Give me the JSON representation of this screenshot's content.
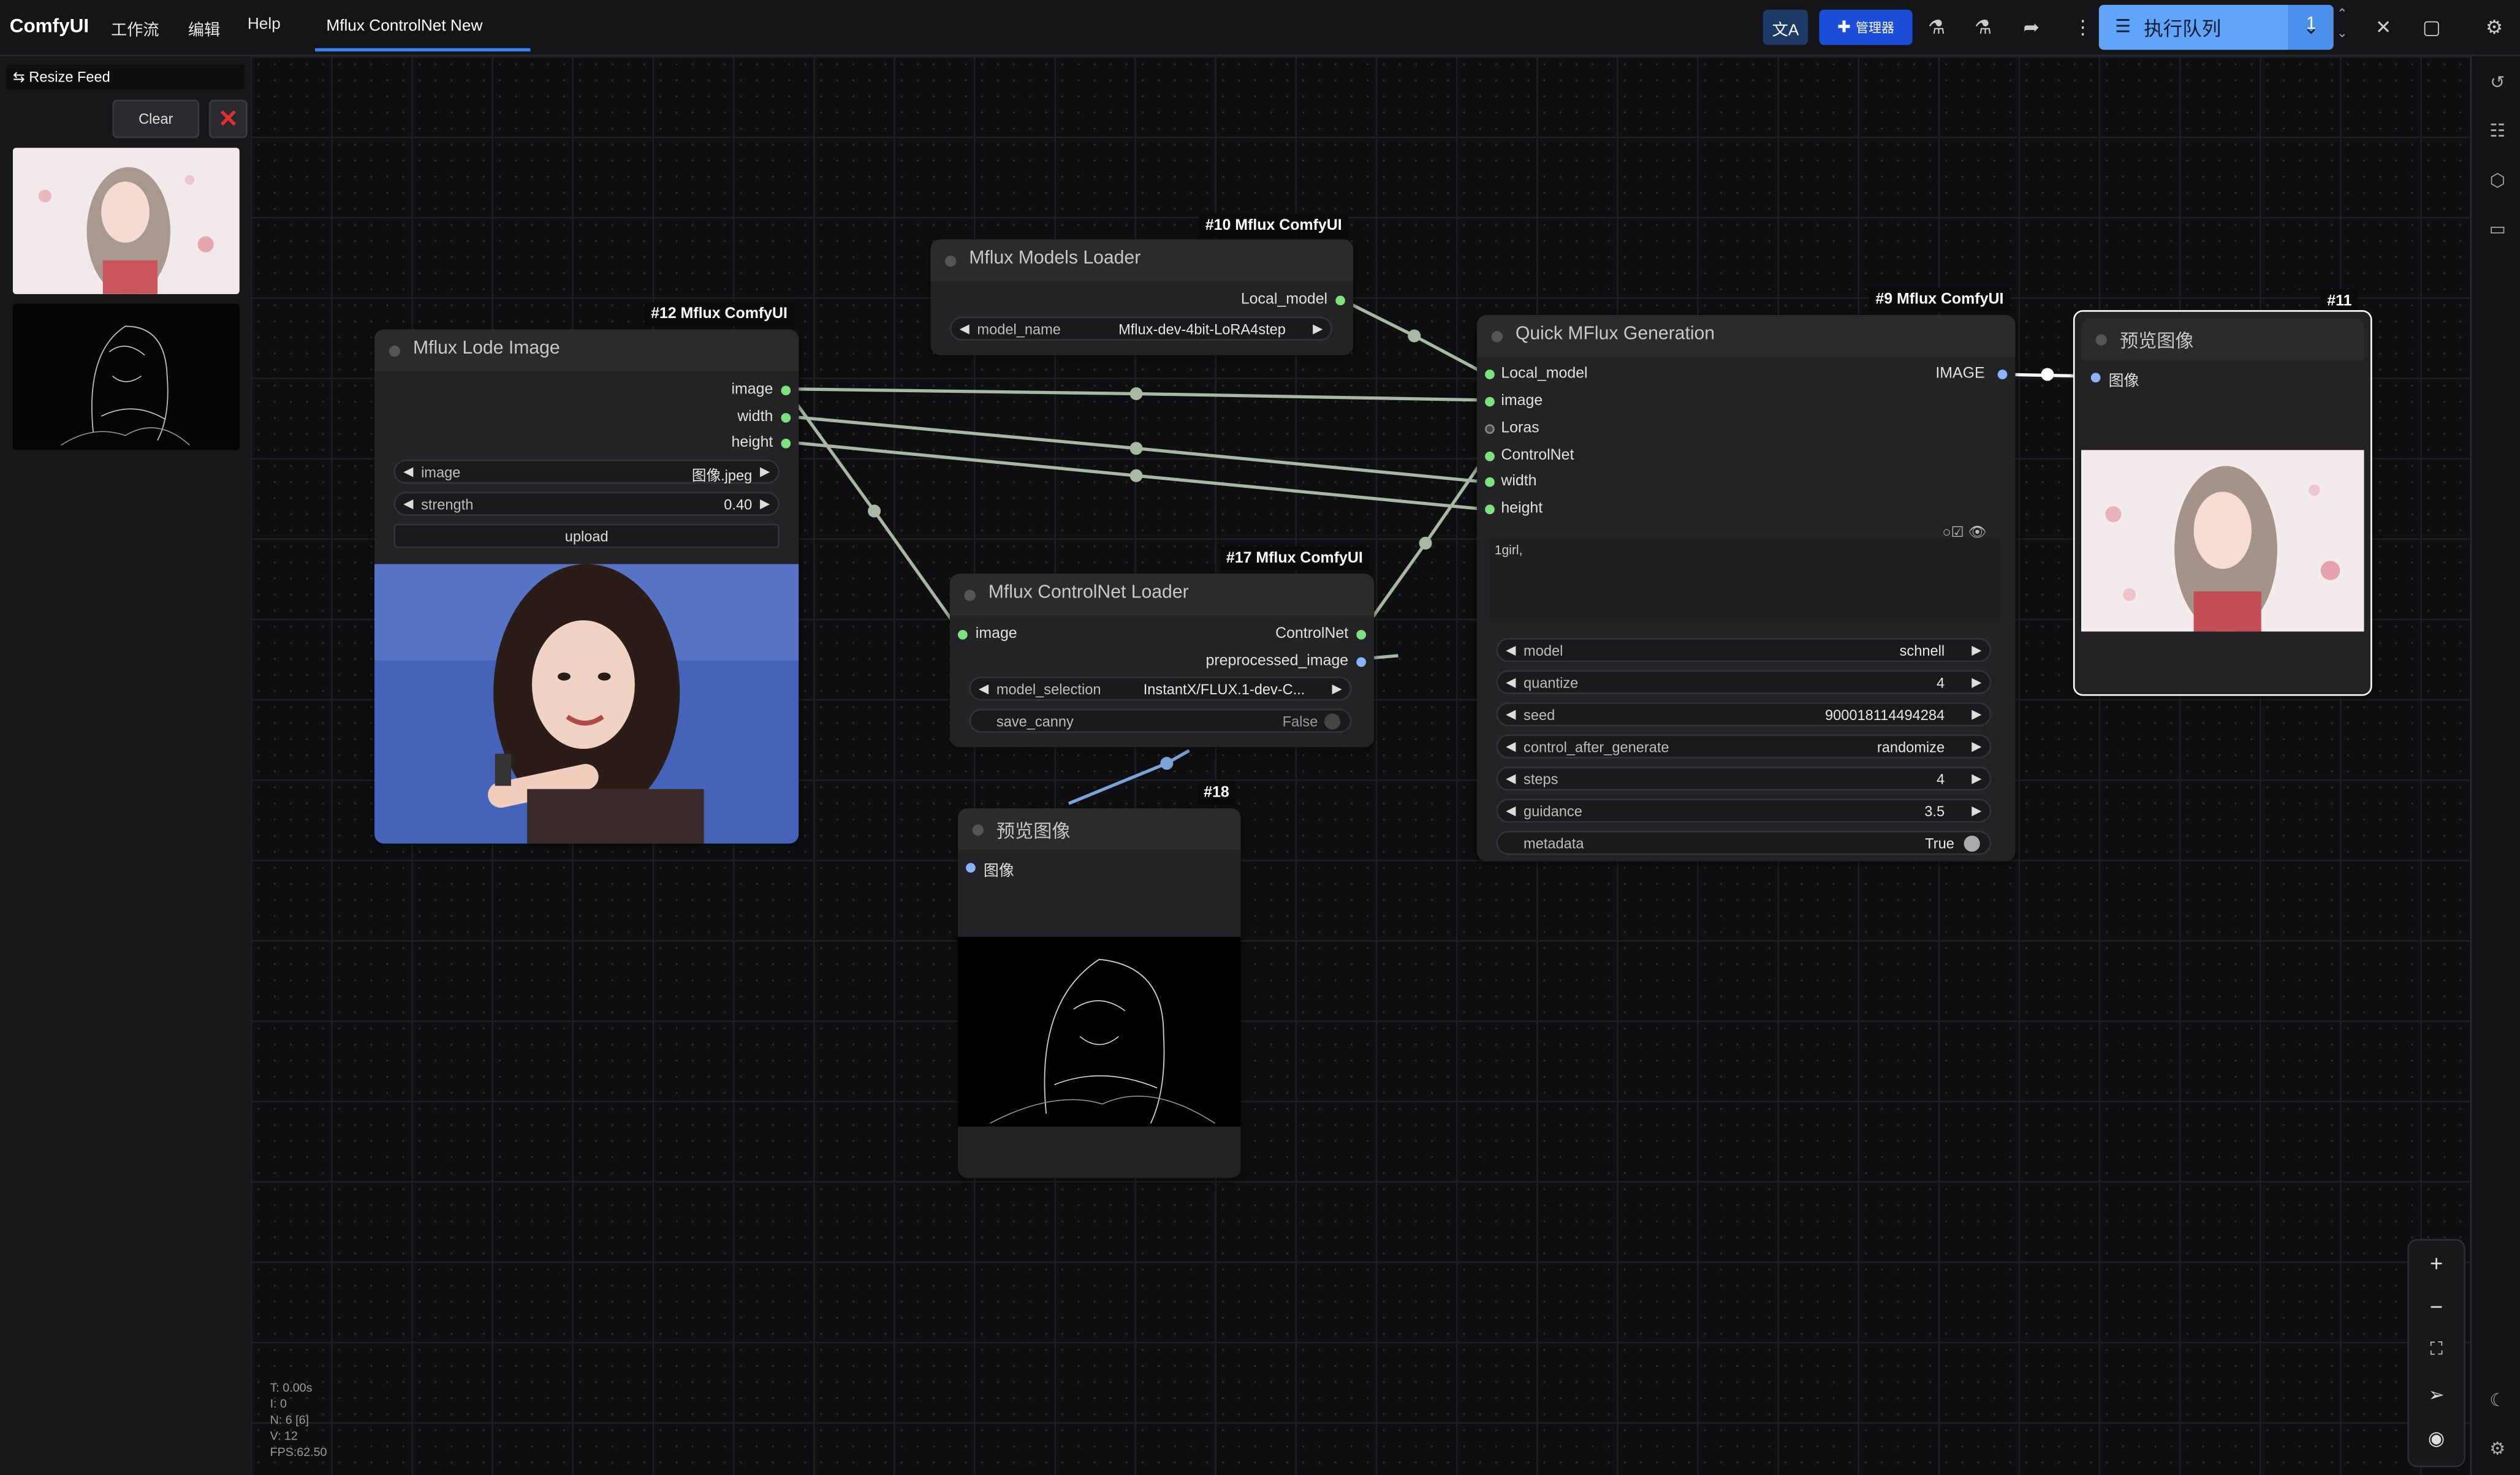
{
  "app": {
    "name": "ComfyUI",
    "menu": [
      "工作流",
      "编辑",
      "Help"
    ],
    "workflow_tab": "Mflux ControlNet New"
  },
  "toolbar": {
    "manager_label": "管理器",
    "queue_label": "执行队列",
    "queue_count": "1"
  },
  "feed": {
    "title": "⇆ Resize Feed",
    "clear_label": "Clear"
  },
  "nodes": {
    "lode_image": {
      "badge": "#12 Mflux ComfyUI",
      "title": "Mflux Lode Image",
      "outputs": [
        "image",
        "width",
        "height"
      ],
      "widgets": [
        {
          "label": "image",
          "value": "图像.jpeg"
        },
        {
          "label": "strength",
          "value": "0.40"
        }
      ],
      "upload_label": "upload"
    },
    "models_loader": {
      "badge": "#10 Mflux ComfyUI",
      "title": "Mflux Models Loader",
      "output": "Local_model",
      "widget": {
        "label": "model_name",
        "value": "Mflux-dev-4bit-LoRA4step"
      }
    },
    "controlnet_loader": {
      "badge": "#17 Mflux ComfyUI",
      "title": "Mflux ControlNet Loader",
      "input": "image",
      "outputs": [
        "ControlNet",
        "preprocessed_image"
      ],
      "widgets": [
        {
          "label": "model_selection",
          "value": "InstantX/FLUX.1-dev-C..."
        },
        {
          "label": "save_canny",
          "value": "False"
        }
      ]
    },
    "quick_gen": {
      "badge": "#9 Mflux ComfyUI",
      "title": "Quick MFlux Generation",
      "inputs": [
        "Local_model",
        "image",
        "Loras",
        "ControlNet",
        "width",
        "height"
      ],
      "output": "IMAGE",
      "prompt": "1girl,",
      "widgets": [
        {
          "label": "model",
          "value": "schnell"
        },
        {
          "label": "quantize",
          "value": "4"
        },
        {
          "label": "seed",
          "value": "900018114494284"
        },
        {
          "label": "control_after_generate",
          "value": "randomize"
        },
        {
          "label": "steps",
          "value": "4"
        },
        {
          "label": "guidance",
          "value": "3.5"
        },
        {
          "label": "metadata",
          "value": "True"
        }
      ]
    },
    "preview_11": {
      "badge": "#11",
      "title": "预览图像",
      "input": "图像"
    },
    "preview_18": {
      "badge": "#18",
      "title": "预览图像",
      "input": "图像"
    }
  },
  "stats": [
    "T: 0.00s",
    "I: 0",
    "N: 6 [6]",
    "V: 12",
    "FPS:62.50"
  ],
  "colors": {
    "accent": "#60a5fa",
    "link": "#9fb49a",
    "pin_green": "#7ee07e",
    "pin_blue": "#8ab4f8",
    "manager": "#1d4ed8"
  }
}
